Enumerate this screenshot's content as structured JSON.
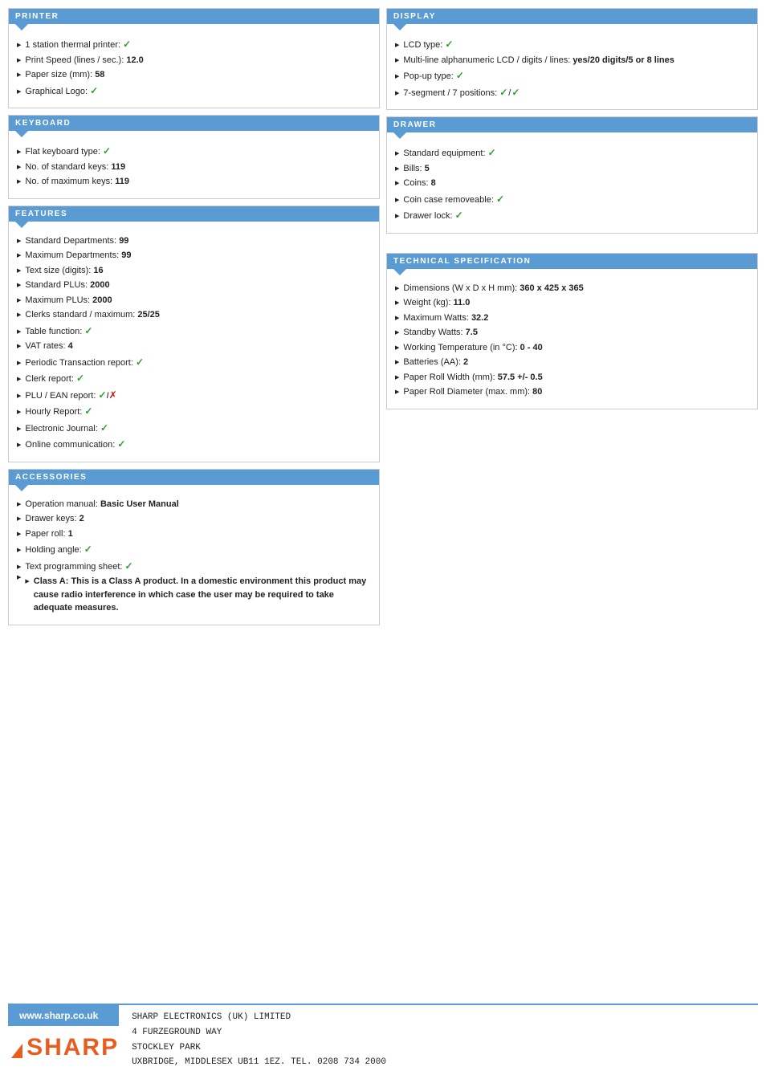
{
  "sections": {
    "printer": {
      "title": "PRINTER",
      "items": [
        {
          "text": "1 station thermal printer:",
          "bold": "",
          "check": true,
          "cross": false
        },
        {
          "text": "Print Speed (lines / sec.):",
          "bold": "12.0",
          "check": false,
          "cross": false
        },
        {
          "text": "Paper size (mm):",
          "bold": "58",
          "check": false,
          "cross": false
        },
        {
          "text": "Graphical Logo:",
          "bold": "",
          "check": true,
          "cross": false
        }
      ]
    },
    "keyboard": {
      "title": "KEYBOARD",
      "items": [
        {
          "text": "Flat keyboard type:",
          "bold": "",
          "check": true,
          "cross": false
        },
        {
          "text": "No. of standard keys:",
          "bold": "119",
          "check": false,
          "cross": false
        },
        {
          "text": "No. of maximum keys:",
          "bold": "119",
          "check": false,
          "cross": false
        }
      ]
    },
    "features": {
      "title": "FEATURES",
      "items": [
        {
          "text": "Standard Departments:",
          "bold": "99",
          "check": false,
          "cross": false
        },
        {
          "text": "Maximum Departments:",
          "bold": "99",
          "check": false,
          "cross": false
        },
        {
          "text": "Text size (digits):",
          "bold": "16",
          "check": false,
          "cross": false
        },
        {
          "text": "Standard PLUs:",
          "bold": "2000",
          "check": false,
          "cross": false
        },
        {
          "text": "Maximum PLUs:",
          "bold": "2000",
          "check": false,
          "cross": false
        },
        {
          "text": "Clerks standard / maximum:",
          "bold": "25/25",
          "check": false,
          "cross": false
        },
        {
          "text": "Table function:",
          "bold": "",
          "check": true,
          "cross": false
        },
        {
          "text": "VAT rates:",
          "bold": "4",
          "check": false,
          "cross": false
        },
        {
          "text": "Periodic Transaction report:",
          "bold": "",
          "check": true,
          "cross": false
        },
        {
          "text": "Clerk report:",
          "bold": "",
          "check": true,
          "cross": false
        },
        {
          "text": "PLU / EAN report:",
          "bold": "",
          "check": true,
          "cross": false,
          "cross2": true
        },
        {
          "text": "Hourly Report:",
          "bold": "",
          "check": true,
          "cross": false
        },
        {
          "text": "Electronic Journal:",
          "bold": "",
          "check": true,
          "cross": false
        },
        {
          "text": "Online communication:",
          "bold": "",
          "check": true,
          "cross": false
        }
      ]
    },
    "accessories": {
      "title": "ACCESSORIES",
      "items": [
        {
          "text": "Operation manual:",
          "bold": "Basic User Manual",
          "check": false,
          "cross": false
        },
        {
          "text": "Drawer keys:",
          "bold": "2",
          "check": false,
          "cross": false
        },
        {
          "text": "Paper roll:",
          "bold": "1",
          "check": false,
          "cross": false
        },
        {
          "text": "Holding angle:",
          "bold": "",
          "check": true,
          "cross": false
        },
        {
          "text": "Text programming sheet:",
          "bold": "",
          "check": true,
          "cross": false
        },
        {
          "text": "Class A:",
          "bold": "This is a Class A product. In a domestic environment this product may cause radio interference in which case the user may be required to take adequate measures.",
          "check": false,
          "cross": false,
          "is_class_a": true
        }
      ]
    },
    "display": {
      "title": "DISPLAY",
      "items": [
        {
          "text": "LCD type:",
          "bold": "",
          "check": true,
          "cross": false
        },
        {
          "text": "Multi-line alphanumeric LCD / digits / lines:",
          "bold": "yes/20 digits/5 or 8 lines",
          "check": false,
          "cross": false
        },
        {
          "text": "Pop-up type:",
          "bold": "",
          "check": true,
          "cross": false
        },
        {
          "text": "7-segment / 7 positions:",
          "bold": "",
          "check": true,
          "cross": false,
          "check2": true
        }
      ]
    },
    "drawer": {
      "title": "DRAWER",
      "items": [
        {
          "text": "Standard equipment:",
          "bold": "",
          "check": true,
          "cross": false
        },
        {
          "text": "Bills:",
          "bold": "5",
          "check": false,
          "cross": false
        },
        {
          "text": "Coins:",
          "bold": "8",
          "check": false,
          "cross": false
        },
        {
          "text": "Coin case removeable:",
          "bold": "",
          "check": true,
          "cross": false
        },
        {
          "text": "Drawer lock:",
          "bold": "",
          "check": true,
          "cross": false
        }
      ]
    },
    "tech_spec": {
      "title": "TECHNICAL SPECIFICATION",
      "items": [
        {
          "text": "Dimensions (W x D x H mm):",
          "bold": "360 x 425 x 365",
          "check": false,
          "cross": false
        },
        {
          "text": "Weight (kg):",
          "bold": "11.0",
          "check": false,
          "cross": false
        },
        {
          "text": "Maximum Watts:",
          "bold": "32.2",
          "check": false,
          "cross": false
        },
        {
          "text": "Standby Watts:",
          "bold": "7.5",
          "check": false,
          "cross": false
        },
        {
          "text": "Working Temperature (in °C):",
          "bold": "0 - 40",
          "check": false,
          "cross": false
        },
        {
          "text": "Batteries (AA):",
          "bold": "2",
          "check": false,
          "cross": false
        },
        {
          "text": "Paper Roll Width (mm):",
          "bold": "57.5 +/- 0.5",
          "check": false,
          "cross": false
        },
        {
          "text": "Paper Roll Diameter (max. mm):",
          "bold": "80",
          "check": false,
          "cross": false
        }
      ]
    }
  },
  "footer": {
    "website": "www.sharp.co.uk",
    "company": "SHARP ELECTRONICS (UK) LIMITED",
    "address_line1": "4 FURZEGROUND WAY",
    "address_line2": "STOCKLEY PARK",
    "address_line3": "UXBRIDGE, MIDDLESEX UB11 1EZ. TEL. 0208 734 2000"
  }
}
